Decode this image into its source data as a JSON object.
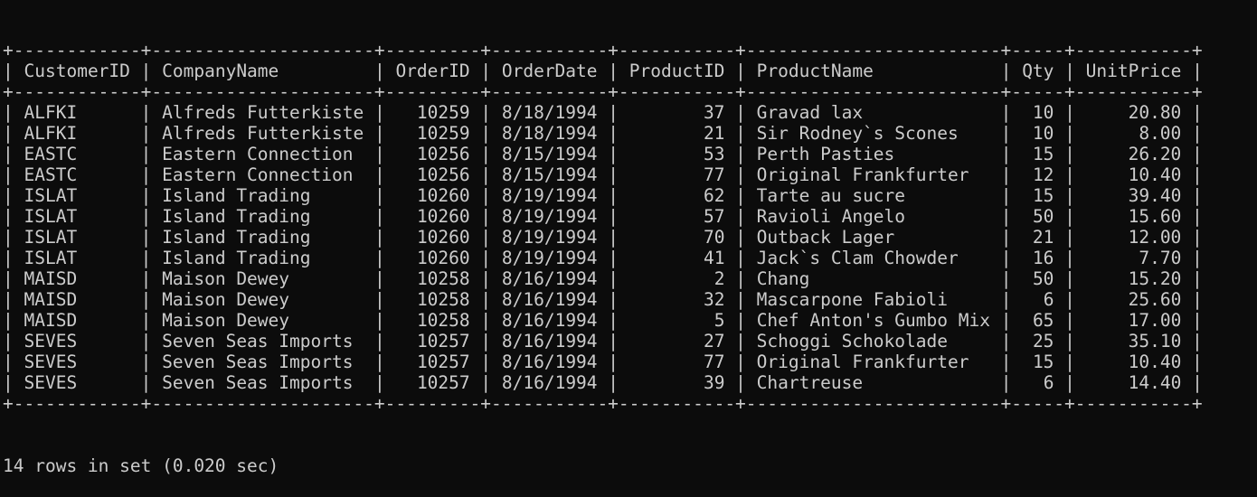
{
  "table": {
    "columns": [
      "CustomerID",
      "CompanyName",
      "OrderID",
      "OrderDate",
      "ProductID",
      "ProductName",
      "Qty",
      "UnitPrice"
    ],
    "align": [
      "left",
      "left",
      "right",
      "left",
      "right",
      "left",
      "right",
      "right"
    ],
    "rows": [
      [
        "ALFKI",
        "Alfreds Futterkiste",
        "10259",
        "8/18/1994",
        "37",
        "Gravad lax",
        "10",
        "20.80"
      ],
      [
        "ALFKI",
        "Alfreds Futterkiste",
        "10259",
        "8/18/1994",
        "21",
        "Sir Rodney`s Scones",
        "10",
        "8.00"
      ],
      [
        "EASTC",
        "Eastern Connection",
        "10256",
        "8/15/1994",
        "53",
        "Perth Pasties",
        "15",
        "26.20"
      ],
      [
        "EASTC",
        "Eastern Connection",
        "10256",
        "8/15/1994",
        "77",
        "Original Frankfurter",
        "12",
        "10.40"
      ],
      [
        "ISLAT",
        "Island Trading",
        "10260",
        "8/19/1994",
        "62",
        "Tarte au sucre",
        "15",
        "39.40"
      ],
      [
        "ISLAT",
        "Island Trading",
        "10260",
        "8/19/1994",
        "57",
        "Ravioli Angelo",
        "50",
        "15.60"
      ],
      [
        "ISLAT",
        "Island Trading",
        "10260",
        "8/19/1994",
        "70",
        "Outback Lager",
        "21",
        "12.00"
      ],
      [
        "ISLAT",
        "Island Trading",
        "10260",
        "8/19/1994",
        "41",
        "Jack`s Clam Chowder",
        "16",
        "7.70"
      ],
      [
        "MAISD",
        "Maison Dewey",
        "10258",
        "8/16/1994",
        "2",
        "Chang",
        "50",
        "15.20"
      ],
      [
        "MAISD",
        "Maison Dewey",
        "10258",
        "8/16/1994",
        "32",
        "Mascarpone Fabioli",
        "6",
        "25.60"
      ],
      [
        "MAISD",
        "Maison Dewey",
        "10258",
        "8/16/1994",
        "5",
        "Chef Anton's Gumbo Mix",
        "65",
        "17.00"
      ],
      [
        "SEVES",
        "Seven Seas Imports",
        "10257",
        "8/16/1994",
        "27",
        "Schoggi Schokolade",
        "25",
        "35.10"
      ],
      [
        "SEVES",
        "Seven Seas Imports",
        "10257",
        "8/16/1994",
        "77",
        "Original Frankfurter",
        "15",
        "10.40"
      ],
      [
        "SEVES",
        "Seven Seas Imports",
        "10257",
        "8/16/1994",
        "39",
        "Chartreuse",
        "6",
        "14.40"
      ]
    ]
  },
  "status": {
    "text": "14 rows in set (0.020 sec)"
  },
  "colors": {
    "background": "#0c0c0c",
    "foreground": "#cccccc"
  }
}
